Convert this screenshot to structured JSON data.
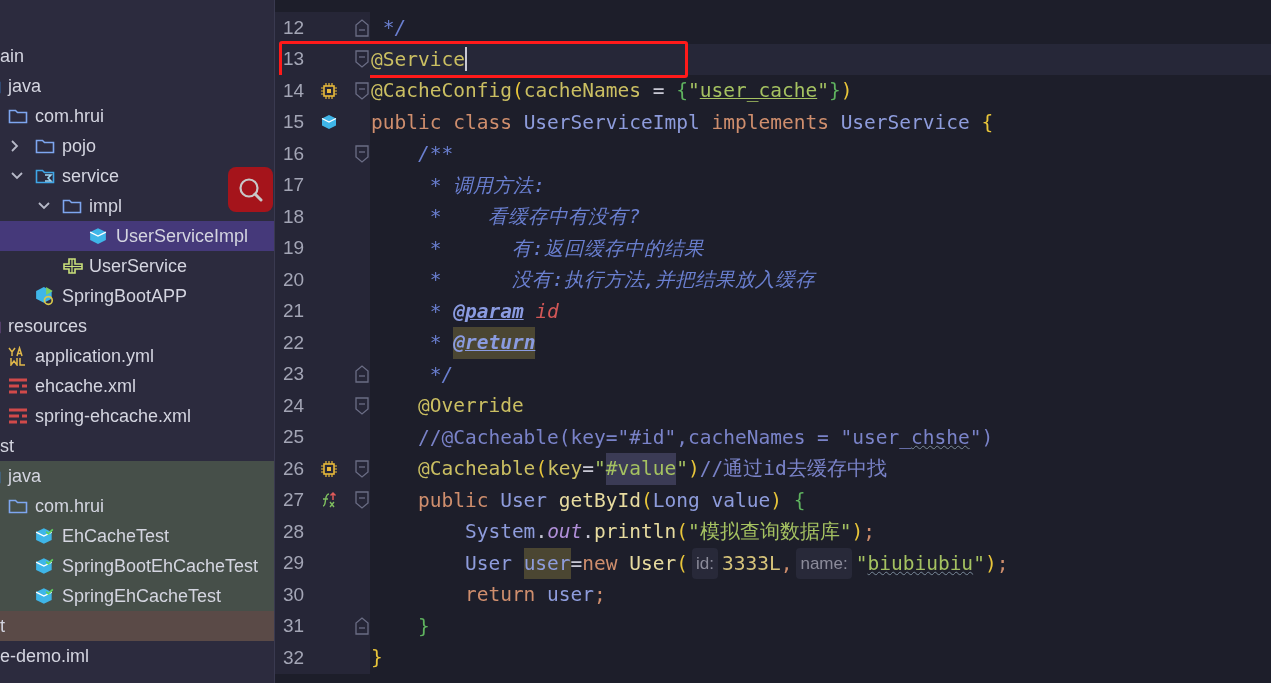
{
  "project_tree": [
    {
      "label": "ain",
      "children": [
        {
          "label": "java",
          "kind": "source-folder",
          "children": [
            {
              "label": "com.hrui",
              "kind": "folder",
              "children": [
                {
                  "label": "pojo",
                  "kind": "folder",
                  "expanded": false
                },
                {
                  "label": "service",
                  "kind": "service-folder",
                  "expanded": true,
                  "children": [
                    {
                      "label": "impl",
                      "kind": "folder",
                      "expanded": true,
                      "children": [
                        {
                          "label": "UserServiceImpl",
                          "kind": "class",
                          "selected": true
                        }
                      ]
                    },
                    {
                      "label": "UserService",
                      "kind": "interface",
                      "selected": false
                    }
                  ]
                },
                {
                  "label": "SpringBootAPP",
                  "kind": "boot-class",
                  "selected": false
                }
              ]
            }
          ]
        },
        {
          "label": "resources",
          "kind": "resources-folder",
          "children": [
            {
              "label": "application.yml",
              "kind": "yaml",
              "selected": false
            },
            {
              "label": "ehcache.xml",
              "kind": "xml",
              "selected": false
            },
            {
              "label": "spring-ehcache.xml",
              "kind": "xml",
              "selected": false
            }
          ]
        }
      ]
    },
    {
      "label": "st",
      "children": [
        {
          "label": "java",
          "kind": "source-folder",
          "color": "#464f49",
          "children": [
            {
              "label": "com.hrui",
              "kind": "folder",
              "color": "#464f49",
              "children": [
                {
                  "label": "EhCacheTest",
                  "kind": "test-class",
                  "color": "#464f49",
                  "selected": false
                },
                {
                  "label": "SpringBootEhCacheTest",
                  "kind": "test-class",
                  "color": "#464f49",
                  "selected": false
                },
                {
                  "label": "SpringEhCacheTest",
                  "kind": "test-class",
                  "color": "#464f49",
                  "selected": false
                }
              ]
            }
          ]
        }
      ]
    },
    {
      "label": "t",
      "color": "#5a4a47"
    },
    {
      "label": "e-demo.iml"
    }
  ],
  "editor": {
    "lines": [
      {
        "number": "12",
        "fold": {
          "kind": "end"
        },
        "tokens": [
          {
            "kind": "doc",
            "text": " */"
          }
        ]
      },
      {
        "number": "13",
        "fold": {
          "kind": "start"
        },
        "current": true,
        "marked": true,
        "tokens": [
          {
            "kind": "ann",
            "text": "@Service"
          }
        ]
      },
      {
        "number": "14",
        "gutter": {
          "kind": "bean"
        },
        "fold": {
          "kind": "start"
        },
        "tokens": [
          {
            "kind": "ann",
            "text": "@CacheConfig"
          },
          {
            "kind": "b1",
            "text": "("
          },
          {
            "kind": "ann",
            "text": "cacheNames"
          },
          {
            "kind": "plain",
            "text": " = "
          },
          {
            "kind": "b2",
            "text": "{"
          },
          {
            "kind": "str",
            "text": "\""
          },
          {
            "kind": "str",
            "text": "user_cache",
            "underlined": true
          },
          {
            "kind": "str",
            "text": "\""
          },
          {
            "kind": "b2",
            "text": "}"
          },
          {
            "kind": "b1",
            "text": ")"
          }
        ]
      },
      {
        "number": "15",
        "gutter": {
          "kind": "class"
        },
        "tokens": [
          {
            "kind": "kw",
            "text": "public class "
          },
          {
            "kind": "type",
            "text": "UserServiceImpl"
          },
          {
            "kind": "kw",
            "text": " implements "
          },
          {
            "kind": "type",
            "text": "UserService"
          },
          {
            "kind": "b1",
            "text": " {"
          }
        ]
      },
      {
        "number": "16",
        "fold": {
          "kind": "start"
        },
        "tokens": [
          {
            "kind": "doc",
            "text": "    /**"
          }
        ]
      },
      {
        "number": "17",
        "tokens": [
          {
            "kind": "doc",
            "text": "     * 调用方法:"
          }
        ]
      },
      {
        "number": "18",
        "tokens": [
          {
            "kind": "doc",
            "text": "     *    看缓存中有没有?"
          }
        ]
      },
      {
        "number": "19",
        "tokens": [
          {
            "kind": "doc",
            "text": "     *      有:返回缓存中的结果"
          }
        ]
      },
      {
        "number": "20",
        "tokens": [
          {
            "kind": "doc",
            "text": "     *      没有:执行方法,并把结果放入缓存"
          }
        ]
      },
      {
        "number": "21",
        "tokens": [
          {
            "kind": "doc",
            "text": "     * "
          },
          {
            "kind": "doctag",
            "text": "@param",
            "underlined": true
          },
          {
            "kind": "param",
            "text": " id"
          }
        ]
      },
      {
        "number": "22",
        "tokens": [
          {
            "kind": "doc",
            "text": "     * "
          },
          {
            "kind": "doctag",
            "text": "@return",
            "underlined": true,
            "highlighted": true
          }
        ]
      },
      {
        "number": "23",
        "fold": {
          "kind": "end"
        },
        "tokens": [
          {
            "kind": "doc",
            "text": "     */"
          }
        ]
      },
      {
        "number": "24",
        "fold": {
          "kind": "start"
        },
        "tokens": [
          {
            "kind": "ann",
            "text": "    @Override"
          }
        ]
      },
      {
        "number": "25",
        "tokens": [
          {
            "kind": "comment",
            "text": "    //@Cacheable(key=\"#id\",cacheNames = \"user_"
          },
          {
            "kind": "comment",
            "text": "chshe",
            "misspelled": true
          },
          {
            "kind": "comment",
            "text": "\")"
          }
        ]
      },
      {
        "number": "26",
        "gutter": {
          "kind": "bean"
        },
        "fold": {
          "kind": "start"
        },
        "tokens": [
          {
            "kind": "ann",
            "text": "    @Cacheable"
          },
          {
            "kind": "b1",
            "text": "("
          },
          {
            "kind": "ann",
            "text": "key"
          },
          {
            "kind": "plain",
            "text": "="
          },
          {
            "kind": "str",
            "text": "\""
          },
          {
            "kind": "str",
            "text": "#value",
            "highlighted": true
          },
          {
            "kind": "str",
            "text": "\""
          },
          {
            "kind": "b1",
            "text": ")"
          },
          {
            "kind": "comment",
            "text": "//通过id去缓存中找"
          }
        ]
      },
      {
        "number": "27",
        "gutter": {
          "kind": "override"
        },
        "fold": {
          "kind": "start"
        },
        "tokens": [
          {
            "kind": "kw",
            "text": "    public "
          },
          {
            "kind": "type",
            "text": "User "
          },
          {
            "kind": "method",
            "text": "getById"
          },
          {
            "kind": "b1",
            "text": "("
          },
          {
            "kind": "type",
            "text": "Long value"
          },
          {
            "kind": "b1",
            "text": ")"
          },
          {
            "kind": "b2",
            "text": " {"
          }
        ]
      },
      {
        "number": "28",
        "tokens": [
          {
            "kind": "type",
            "text": "        System"
          },
          {
            "kind": "plain",
            "text": "."
          },
          {
            "kind": "field",
            "text": "out"
          },
          {
            "kind": "plain",
            "text": "."
          },
          {
            "kind": "method",
            "text": "println"
          },
          {
            "kind": "b1",
            "text": "("
          },
          {
            "kind": "str",
            "text": "\"模拟查询数据库\""
          },
          {
            "kind": "b1",
            "text": ")"
          },
          {
            "kind": "kw",
            "text": ";"
          }
        ]
      },
      {
        "number": "29",
        "tokens": [
          {
            "kind": "type",
            "text": "        User "
          },
          {
            "kind": "type",
            "text": "user",
            "highlighted": true
          },
          {
            "kind": "plain",
            "text": "="
          },
          {
            "kind": "kw",
            "text": "new "
          },
          {
            "kind": "method",
            "text": "User"
          },
          {
            "kind": "b1",
            "text": "("
          },
          {
            "kind": "hint",
            "text": "id:"
          },
          {
            "kind": "num",
            "text": "3333L"
          },
          {
            "kind": "kw",
            "text": ","
          },
          {
            "kind": "hint",
            "text": "name:"
          },
          {
            "kind": "str",
            "text": "\""
          },
          {
            "kind": "str",
            "text": "biubiubiu",
            "misspelled": true
          },
          {
            "kind": "str",
            "text": "\""
          },
          {
            "kind": "b1",
            "text": ")"
          },
          {
            "kind": "kw",
            "text": ";"
          }
        ]
      },
      {
        "number": "30",
        "tokens": [
          {
            "kind": "kw",
            "text": "        return "
          },
          {
            "kind": "type",
            "text": "user"
          },
          {
            "kind": "kw",
            "text": ";"
          }
        ]
      },
      {
        "number": "31",
        "fold": {
          "kind": "end"
        },
        "tokens": [
          {
            "kind": "b2",
            "text": "    }"
          }
        ]
      },
      {
        "number": "32",
        "tokens": [
          {
            "kind": "b1",
            "text": "}"
          }
        ]
      }
    ]
  }
}
